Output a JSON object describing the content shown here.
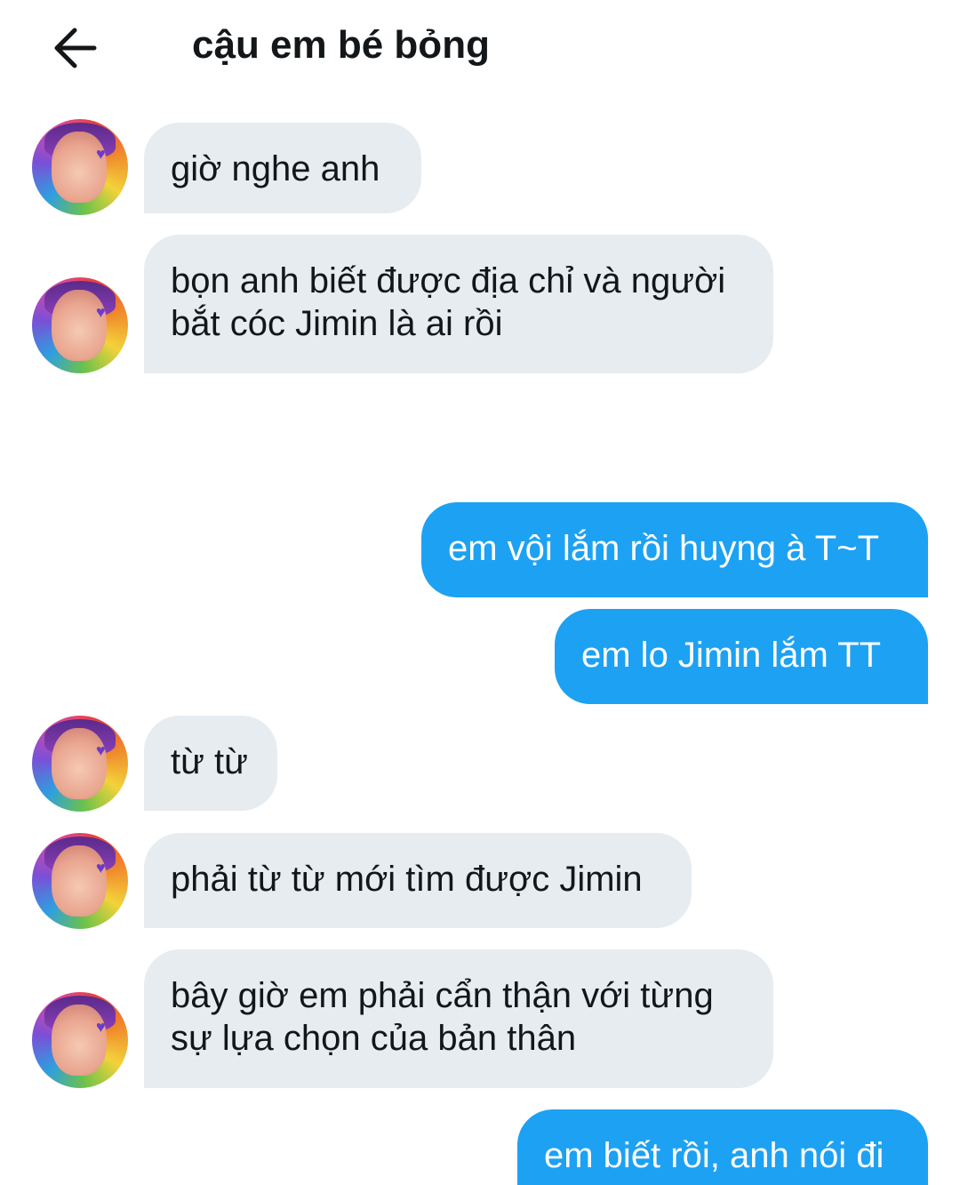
{
  "header": {
    "title": "cậu em bé bỏng"
  },
  "icons": {
    "back": "arrow-left-icon",
    "avatar": "avatar"
  },
  "colors": {
    "received_bubble": "#e6ecf0",
    "sent_bubble": "#1da1f2",
    "text": "#14171a"
  },
  "messages": [
    {
      "from": "them",
      "text": "giờ nghe anh"
    },
    {
      "from": "them",
      "text": "bọn anh biết được địa chỉ và người\nbắt cóc Jimin là ai rồi"
    },
    {
      "from": "me",
      "text": "em vội lắm rồi huyng à T~T"
    },
    {
      "from": "me",
      "text": "em lo Jimin lắm TT"
    },
    {
      "from": "them",
      "text": "từ từ"
    },
    {
      "from": "them",
      "text": "phải từ từ mới tìm được Jimin"
    },
    {
      "from": "them",
      "text": "bây giờ em phải cẩn thận với từng\nsự lựa chọn của bản thân"
    },
    {
      "from": "me",
      "text": "em biết rồi, anh nói đi"
    }
  ]
}
